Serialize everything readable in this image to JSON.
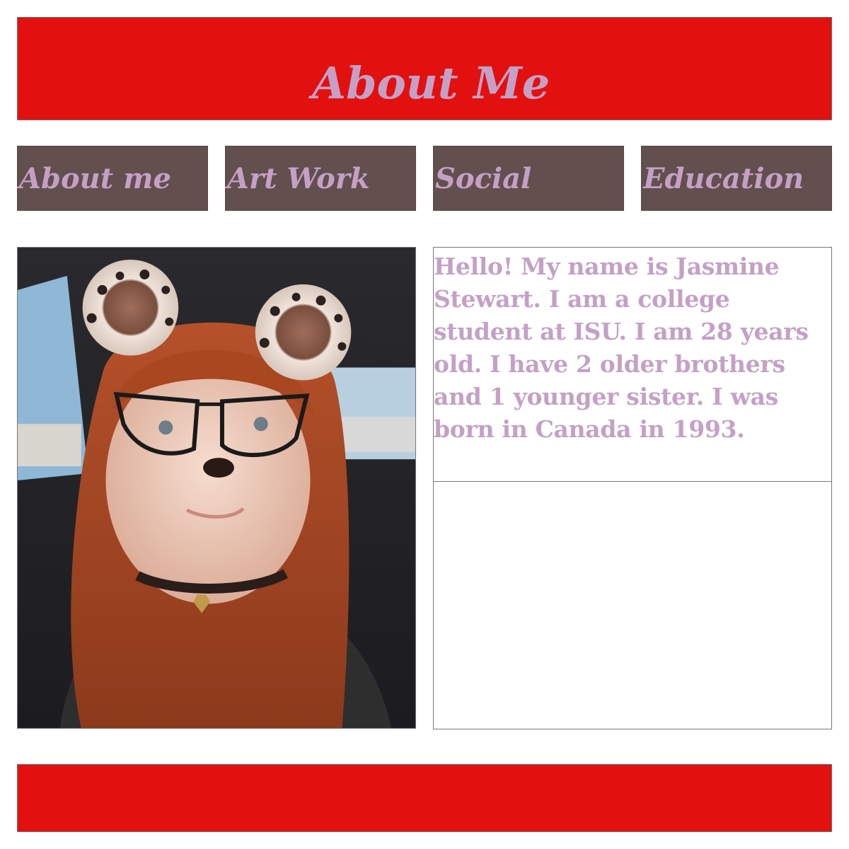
{
  "header": {
    "title": "About Me"
  },
  "nav": {
    "items": [
      {
        "label": "About me"
      },
      {
        "label": "Art Work"
      },
      {
        "label": "Social"
      },
      {
        "label": "Education"
      }
    ]
  },
  "bio": {
    "text": "Hello! My name is Jasmine Stewart. I am a college student at ISU. I am 28 years old. I have 2 older brothers and 1 younger sister. I was born in Canada in 1993."
  },
  "colors": {
    "banner": "#e31010",
    "nav_background": "#624f4e",
    "text_accent": "#c4a0c6"
  }
}
